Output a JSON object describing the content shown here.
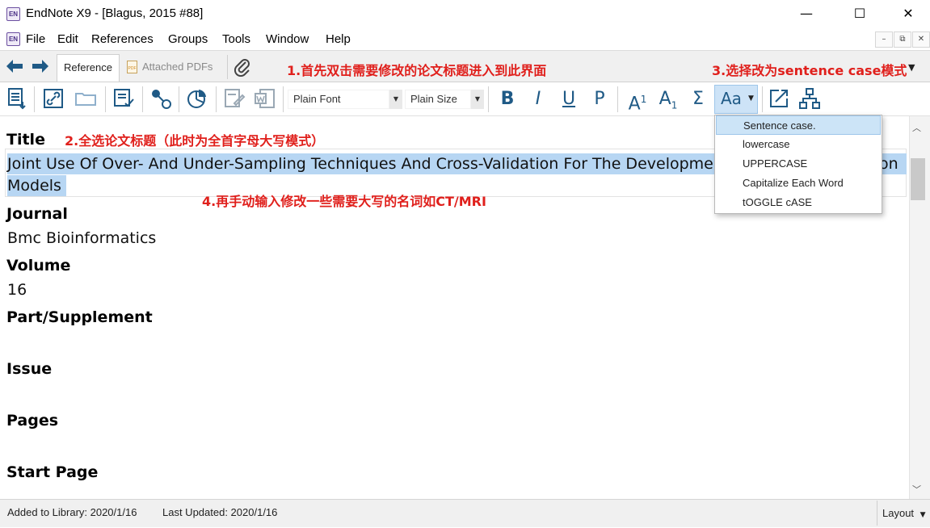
{
  "window": {
    "app_icon": "EN",
    "title": "EndNote X9 - [Blagus, 2015 #88]",
    "minimize": "—",
    "maximize": "☐",
    "close": "✕"
  },
  "menubar": {
    "items": [
      "File",
      "Edit",
      "References",
      "Groups",
      "Tools",
      "Window",
      "Help"
    ],
    "mdi": [
      "–",
      "⧉",
      "✕"
    ]
  },
  "tabs": {
    "reference": "Reference",
    "attached_pdfs": "Attached PDFs",
    "pdf_icon_text": "PDF"
  },
  "toolbar": {
    "font": "Plain Font",
    "size": "Plain Size",
    "bold": "B",
    "italic": "I",
    "underline": "U",
    "plain": "P",
    "superscript": "A",
    "superscript_mark": "1",
    "subscript": "A",
    "subscript_mark": "1",
    "symbol": "Σ",
    "change_case": "Aa"
  },
  "annotations": {
    "step1": "1.首先双击需要修改的论文标题进入到此界面",
    "step2": "2.全选论文标题（此时为全首字母大写模式）",
    "step3": "3.选择改为sentence case模式",
    "step4": "4.再手动输入修改一些需要大写的名词如CT/MRI"
  },
  "case_menu": {
    "items": [
      "Sentence case.",
      "lowercase",
      "UPPERCASE",
      "Capitalize Each Word",
      "tOGGLE cASE"
    ],
    "active_index": 0
  },
  "fields": {
    "title_label": "Title",
    "title_line1": "Joint Use Of Over- And Under-Sampling Techniques And Cross-Validation For The Development And",
    "title_line1_tail": "on",
    "title_line2": "Models",
    "journal_label": "Journal",
    "journal_value": "Bmc Bioinformatics",
    "volume_label": "Volume",
    "volume_value": "16",
    "part_label": "Part/Supplement",
    "issue_label": "Issue",
    "pages_label": "Pages",
    "start_page_label": "Start Page"
  },
  "status": {
    "added": "Added to Library: 2020/1/16",
    "updated": "Last Updated: 2020/1/16",
    "layout": "Layout"
  },
  "colors": {
    "accent": "#1f5a86",
    "annotation": "#e0201c",
    "selection": "#b7d6f3",
    "menu_highlight": "#cce4f7"
  }
}
